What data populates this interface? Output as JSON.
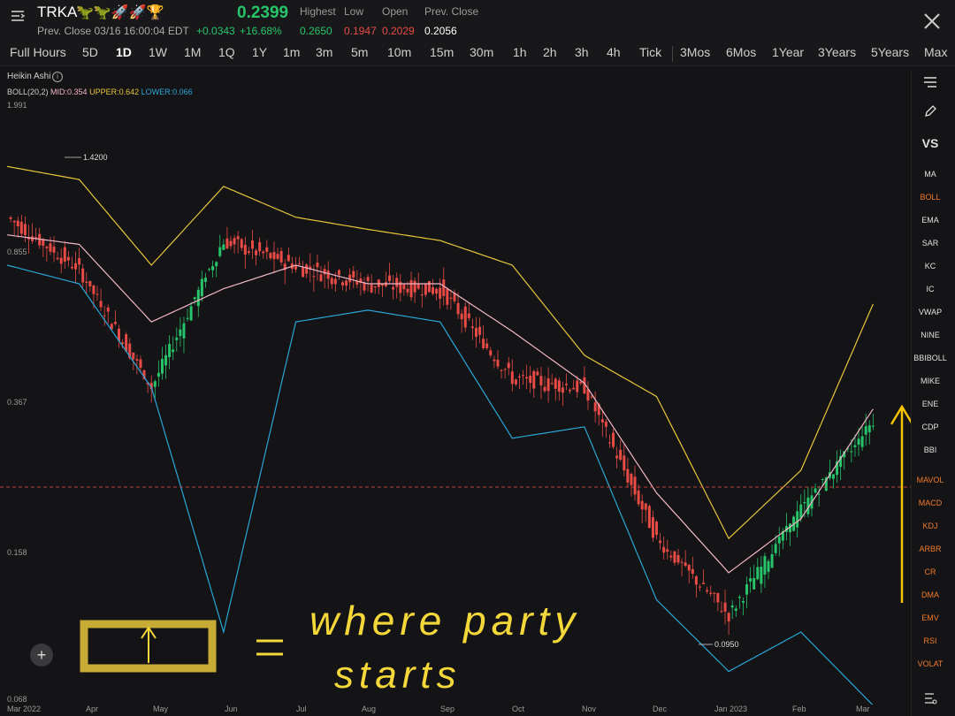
{
  "header": {
    "symbol": "TRKA",
    "emoji": "🦖🦖🚀🚀🏆",
    "price": "0.2399",
    "prev_close_time": "Prev. Close 03/16 16:00:04 EDT",
    "change": "+0.0343",
    "change_pct": "+16.68%",
    "stats": [
      {
        "label": "Highest",
        "value": "0.2650",
        "color": "#27c46a"
      },
      {
        "label": "Low",
        "value": "0.1947",
        "color": "#e84b45"
      },
      {
        "label": "Open",
        "value": "0.2029",
        "color": "#e84b45"
      },
      {
        "label": "Prev. Close",
        "value": "0.2056",
        "color": "#ffffff"
      }
    ]
  },
  "timeframes": [
    "Full Hours",
    "5D",
    "1D",
    "1W",
    "1M",
    "1Q",
    "1Y",
    "1m",
    "3m",
    "5m",
    "10m",
    "15m",
    "30m",
    "1h",
    "2h",
    "3h",
    "4h",
    "Tick",
    "3Mos",
    "6Mos",
    "1Year",
    "3Years",
    "5Years",
    "Max"
  ],
  "active_timeframe": "1D",
  "indicator": {
    "title": "Heikin Ashi",
    "boll_name": "BOLL(20,2)",
    "mid": "MID:0.354",
    "upper": "UPPER:0.642",
    "lower": "LOWER:0.066"
  },
  "colors": {
    "up": "#27c46a",
    "down": "#e84b45",
    "mid": "#f2b6c8",
    "upper": "#e8c53a",
    "lower": "#2aa6d8"
  },
  "y_axis": [
    "1.991",
    "0.855",
    "0.367",
    "0.158",
    "0.068"
  ],
  "x_axis": [
    "Mar 2022",
    "Apr",
    "May",
    "Jun",
    "Jul",
    "Aug",
    "Sep",
    "Oct",
    "Nov",
    "Dec",
    "Jan 2023",
    "Feb",
    "Mar"
  ],
  "annotations": {
    "high_label": "1.4200",
    "low_label": "0.0950",
    "handwritten_1": "where party",
    "handwritten_2": "starts"
  },
  "right_toolbar": {
    "icons": [
      "list-icon",
      "pencil-icon"
    ],
    "vs": "VS",
    "main_indicators": [
      "MA",
      "BOLL",
      "EMA",
      "SAR",
      "KC",
      "IC",
      "VWAP",
      "NINE",
      "BBIBOLL",
      "MIKE",
      "ENE",
      "CDP",
      "BBI"
    ],
    "active_main": "BOLL",
    "sub_indicators": [
      "MAVOL",
      "MACD",
      "KDJ",
      "ARBR",
      "CR",
      "DMA",
      "EMV",
      "RSI",
      "VOLAT"
    ]
  },
  "chart_data": {
    "type": "line",
    "title": "",
    "scale": "log",
    "ylim": [
      0.068,
      1.991
    ],
    "x": [
      "Mar 2022",
      "Apr",
      "May",
      "Jun",
      "Jul",
      "Aug",
      "Sep",
      "Oct",
      "Nov",
      "Dec",
      "Jan 2023",
      "Feb",
      "Mar"
    ],
    "series": [
      {
        "name": "Heikin Ashi close",
        "values": [
          1.05,
          0.78,
          0.4,
          0.92,
          0.8,
          0.72,
          0.7,
          0.42,
          0.4,
          0.17,
          0.11,
          0.2,
          0.33
        ]
      },
      {
        "name": "MID",
        "values": [
          0.95,
          0.9,
          0.58,
          0.7,
          0.8,
          0.72,
          0.72,
          0.55,
          0.41,
          0.22,
          0.14,
          0.19,
          0.354
        ]
      },
      {
        "name": "UPPER",
        "values": [
          1.4,
          1.3,
          0.8,
          1.25,
          1.05,
          0.98,
          0.92,
          0.8,
          0.48,
          0.38,
          0.17,
          0.25,
          0.642
        ]
      },
      {
        "name": "LOWER",
        "values": [
          0.8,
          0.72,
          0.4,
          0.1,
          0.58,
          0.62,
          0.58,
          0.3,
          0.32,
          0.12,
          0.08,
          0.1,
          0.066
        ]
      }
    ],
    "current_price_line": 0.2399
  }
}
